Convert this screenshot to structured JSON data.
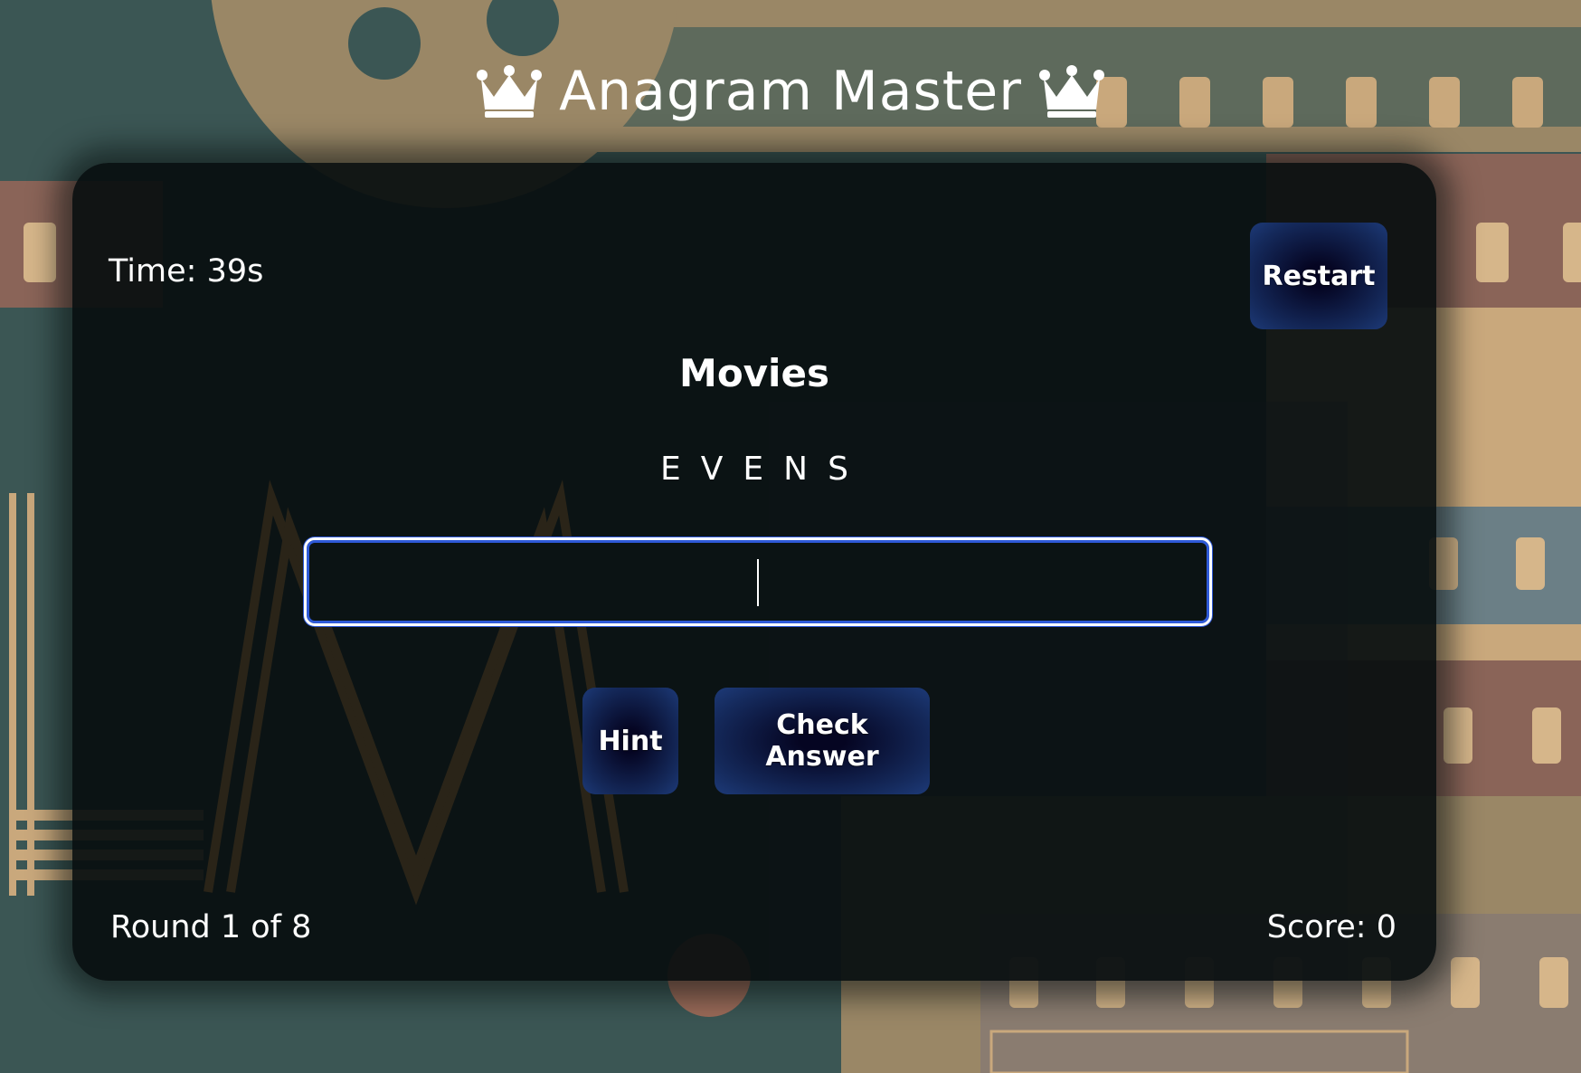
{
  "header": {
    "title": "Anagram Master"
  },
  "game": {
    "timer_text": "Time: 39s",
    "restart_label": "Restart",
    "category": "Movies",
    "scrambled_word": "EVENS",
    "answer_value": "",
    "hint_label": "Hint",
    "check_label": "Check Answer",
    "round_text": "Round 1 of 8",
    "score_text": "Score: 0"
  },
  "icons": {
    "title_left": "crown-icon",
    "title_right": "crown-icon"
  },
  "colors": {
    "button_dark": "#050522",
    "button_edge": "#1d3a78",
    "input_focus": "#2f5ad8",
    "panel_bg": "#0b1314"
  }
}
